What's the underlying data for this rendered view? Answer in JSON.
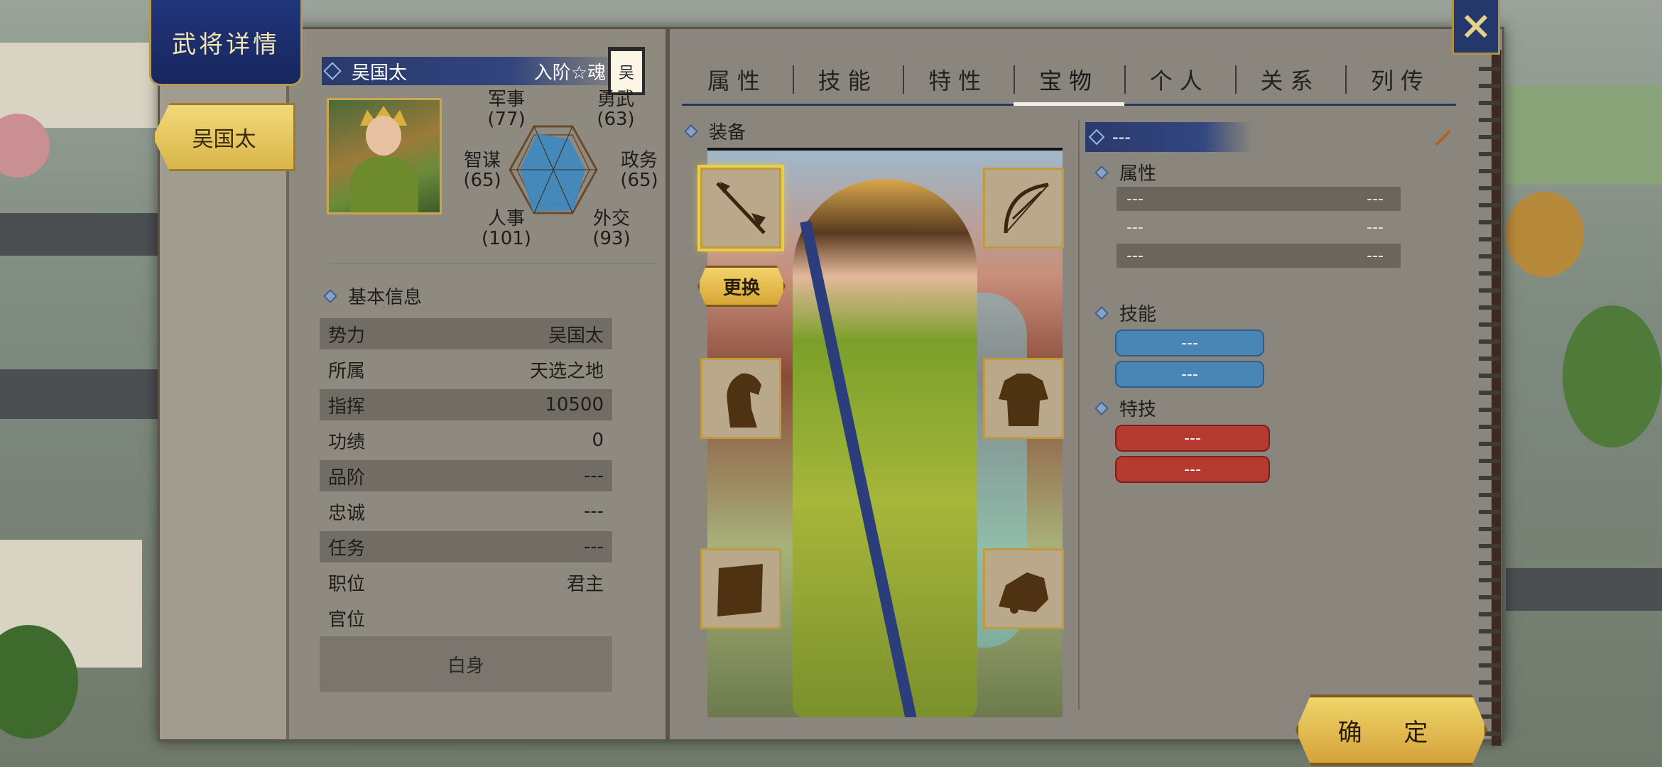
{
  "title": "武将详情",
  "hero": {
    "name": "吴国太",
    "rank": "入阶☆魂",
    "faction_badge": "吴",
    "stats": [
      {
        "key": "military",
        "label": "军事",
        "value": "(77)"
      },
      {
        "key": "valor",
        "label": "勇武",
        "value": "(63)"
      },
      {
        "key": "strategy",
        "label": "智谋",
        "value": "(65)"
      },
      {
        "key": "politics",
        "label": "政务",
        "value": "(65)"
      },
      {
        "key": "personnel",
        "label": "人事",
        "value": "(101)"
      },
      {
        "key": "diplomacy",
        "label": "外交",
        "value": "(93)"
      }
    ]
  },
  "basic_info": {
    "heading": "基本信息",
    "rows": [
      {
        "k": "势力",
        "v": "吴国太"
      },
      {
        "k": "所属",
        "v": "天选之地"
      },
      {
        "k": "指挥",
        "v": "10500"
      },
      {
        "k": "功绩",
        "v": "0"
      },
      {
        "k": "品阶",
        "v": "---"
      },
      {
        "k": "忠诚",
        "v": "---"
      },
      {
        "k": "任务",
        "v": "---"
      },
      {
        "k": "职位",
        "v": "君主"
      },
      {
        "k": "官位",
        "v": ""
      }
    ],
    "office_value": "白身"
  },
  "tabs": [
    "属性",
    "技能",
    "特性",
    "宝物",
    "个人",
    "关系",
    "列传"
  ],
  "active_tab": "宝物",
  "equipment": {
    "heading": "装备",
    "swap_label": "更换",
    "slots": [
      {
        "name": "weapon",
        "icon": "halberd-icon"
      },
      {
        "name": "bow",
        "icon": "bow-icon"
      },
      {
        "name": "horse",
        "icon": "horse-icon"
      },
      {
        "name": "armor",
        "icon": "armor-icon"
      },
      {
        "name": "book",
        "icon": "scroll-icon"
      },
      {
        "name": "treasure",
        "icon": "item-icon"
      }
    ]
  },
  "treasure": {
    "name": "---",
    "attr_heading": "属性",
    "attrs": [
      {
        "a": "---",
        "b": "---"
      },
      {
        "a": "---",
        "b": "---"
      },
      {
        "a": "---",
        "b": "---"
      }
    ],
    "skill_heading": "技能",
    "skills": [
      "---",
      "---"
    ],
    "special_heading": "特技",
    "specials": [
      "---",
      "---"
    ]
  },
  "confirm_label": "确 定",
  "colors": {
    "navy": "#24386c",
    "gold": "#d8b54a",
    "skill_blue": "#4a86b5",
    "special_red": "#b53a30"
  }
}
